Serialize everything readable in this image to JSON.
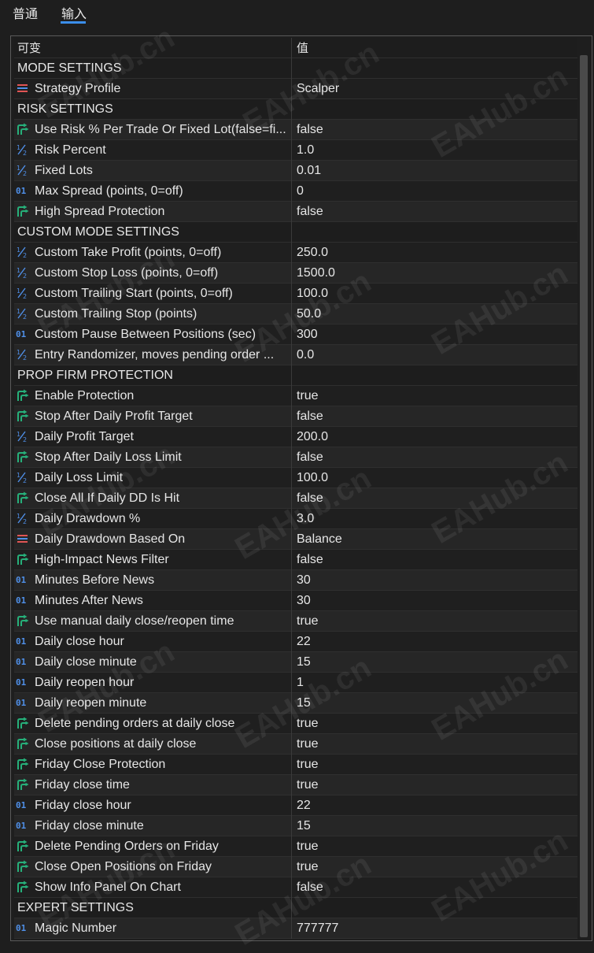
{
  "tabs": [
    {
      "label": "普通",
      "active": false
    },
    {
      "label": "输入",
      "active": true
    }
  ],
  "accent_color": "#3b8eea",
  "watermark": "EAHub.cn",
  "columns": {
    "name": "可变",
    "value": "值"
  },
  "rows": [
    {
      "type": "section",
      "name": "MODE SETTINGS"
    },
    {
      "type": "param",
      "icon": "enum-icon",
      "name": "Strategy Profile",
      "value": "Scalper"
    },
    {
      "type": "section",
      "name": "RISK SETTINGS"
    },
    {
      "type": "param",
      "icon": "bool-icon",
      "name": "Use Risk % Per Trade Or Fixed Lot(false=fi...",
      "value": "false"
    },
    {
      "type": "param",
      "icon": "double-icon",
      "name": "Risk Percent",
      "value": "1.0"
    },
    {
      "type": "param",
      "icon": "double-icon",
      "name": "Fixed Lots",
      "value": "0.01"
    },
    {
      "type": "param",
      "icon": "int-icon",
      "name": "Max Spread (points, 0=off)",
      "value": "0"
    },
    {
      "type": "param",
      "icon": "bool-icon",
      "name": "High Spread Protection",
      "value": "false"
    },
    {
      "type": "section",
      "name": "CUSTOM MODE SETTINGS"
    },
    {
      "type": "param",
      "icon": "double-icon",
      "name": "Custom Take Profit (points, 0=off)",
      "value": "250.0"
    },
    {
      "type": "param",
      "icon": "double-icon",
      "name": "Custom Stop Loss (points, 0=off)",
      "value": "1500.0"
    },
    {
      "type": "param",
      "icon": "double-icon",
      "name": "Custom Trailing Start (points, 0=off)",
      "value": "100.0"
    },
    {
      "type": "param",
      "icon": "double-icon",
      "name": "Custom Trailing Stop (points)",
      "value": "50.0"
    },
    {
      "type": "param",
      "icon": "int-icon",
      "name": "Custom Pause Between Positions (sec)",
      "value": "300"
    },
    {
      "type": "param",
      "icon": "double-icon",
      "name": "Entry Randomizer, moves pending order ...",
      "value": "0.0"
    },
    {
      "type": "section",
      "name": "PROP FIRM PROTECTION"
    },
    {
      "type": "param",
      "icon": "bool-icon",
      "name": "Enable Protection",
      "value": "true"
    },
    {
      "type": "param",
      "icon": "bool-icon",
      "name": "Stop After Daily Profit Target",
      "value": "false"
    },
    {
      "type": "param",
      "icon": "double-icon",
      "name": "Daily Profit Target",
      "value": "200.0"
    },
    {
      "type": "param",
      "icon": "bool-icon",
      "name": "Stop After Daily Loss Limit",
      "value": "false"
    },
    {
      "type": "param",
      "icon": "double-icon",
      "name": "Daily Loss Limit",
      "value": "100.0"
    },
    {
      "type": "param",
      "icon": "bool-icon",
      "name": "Close All If Daily DD Is Hit",
      "value": "false"
    },
    {
      "type": "param",
      "icon": "double-icon",
      "name": "Daily Drawdown %",
      "value": "3.0"
    },
    {
      "type": "param",
      "icon": "enum-icon",
      "name": "Daily Drawdown Based On",
      "value": "Balance"
    },
    {
      "type": "param",
      "icon": "bool-icon",
      "name": "High-Impact News Filter",
      "value": "false"
    },
    {
      "type": "param",
      "icon": "int-icon",
      "name": "Minutes Before News",
      "value": "30"
    },
    {
      "type": "param",
      "icon": "int-icon",
      "name": "Minutes After News",
      "value": "30"
    },
    {
      "type": "param",
      "icon": "bool-icon",
      "name": "Use manual daily close/reopen time",
      "value": "true"
    },
    {
      "type": "param",
      "icon": "int-icon",
      "name": "Daily close hour",
      "value": "22"
    },
    {
      "type": "param",
      "icon": "int-icon",
      "name": "Daily close minute",
      "value": "15"
    },
    {
      "type": "param",
      "icon": "int-icon",
      "name": "Daily reopen hour",
      "value": "1"
    },
    {
      "type": "param",
      "icon": "int-icon",
      "name": "Daily reopen minute",
      "value": "15"
    },
    {
      "type": "param",
      "icon": "bool-icon",
      "name": "Delete pending orders at daily close",
      "value": "true"
    },
    {
      "type": "param",
      "icon": "bool-icon",
      "name": "Close positions at daily close",
      "value": "true"
    },
    {
      "type": "param",
      "icon": "bool-icon",
      "name": "Friday Close Protection",
      "value": "true"
    },
    {
      "type": "param",
      "icon": "bool-icon",
      "name": "Friday close time",
      "value": "true"
    },
    {
      "type": "param",
      "icon": "int-icon",
      "name": "Friday close hour",
      "value": "22"
    },
    {
      "type": "param",
      "icon": "int-icon",
      "name": "Friday close minute",
      "value": "15"
    },
    {
      "type": "param",
      "icon": "bool-icon",
      "name": "Delete Pending Orders on Friday",
      "value": "true"
    },
    {
      "type": "param",
      "icon": "bool-icon",
      "name": "Close Open Positions on Friday",
      "value": "true"
    },
    {
      "type": "param",
      "icon": "bool-icon",
      "name": "Show Info Panel On Chart",
      "value": "false"
    },
    {
      "type": "section",
      "name": "EXPERT SETTINGS"
    },
    {
      "type": "param",
      "icon": "int-icon",
      "name": "Magic Number",
      "value": "777777"
    }
  ]
}
